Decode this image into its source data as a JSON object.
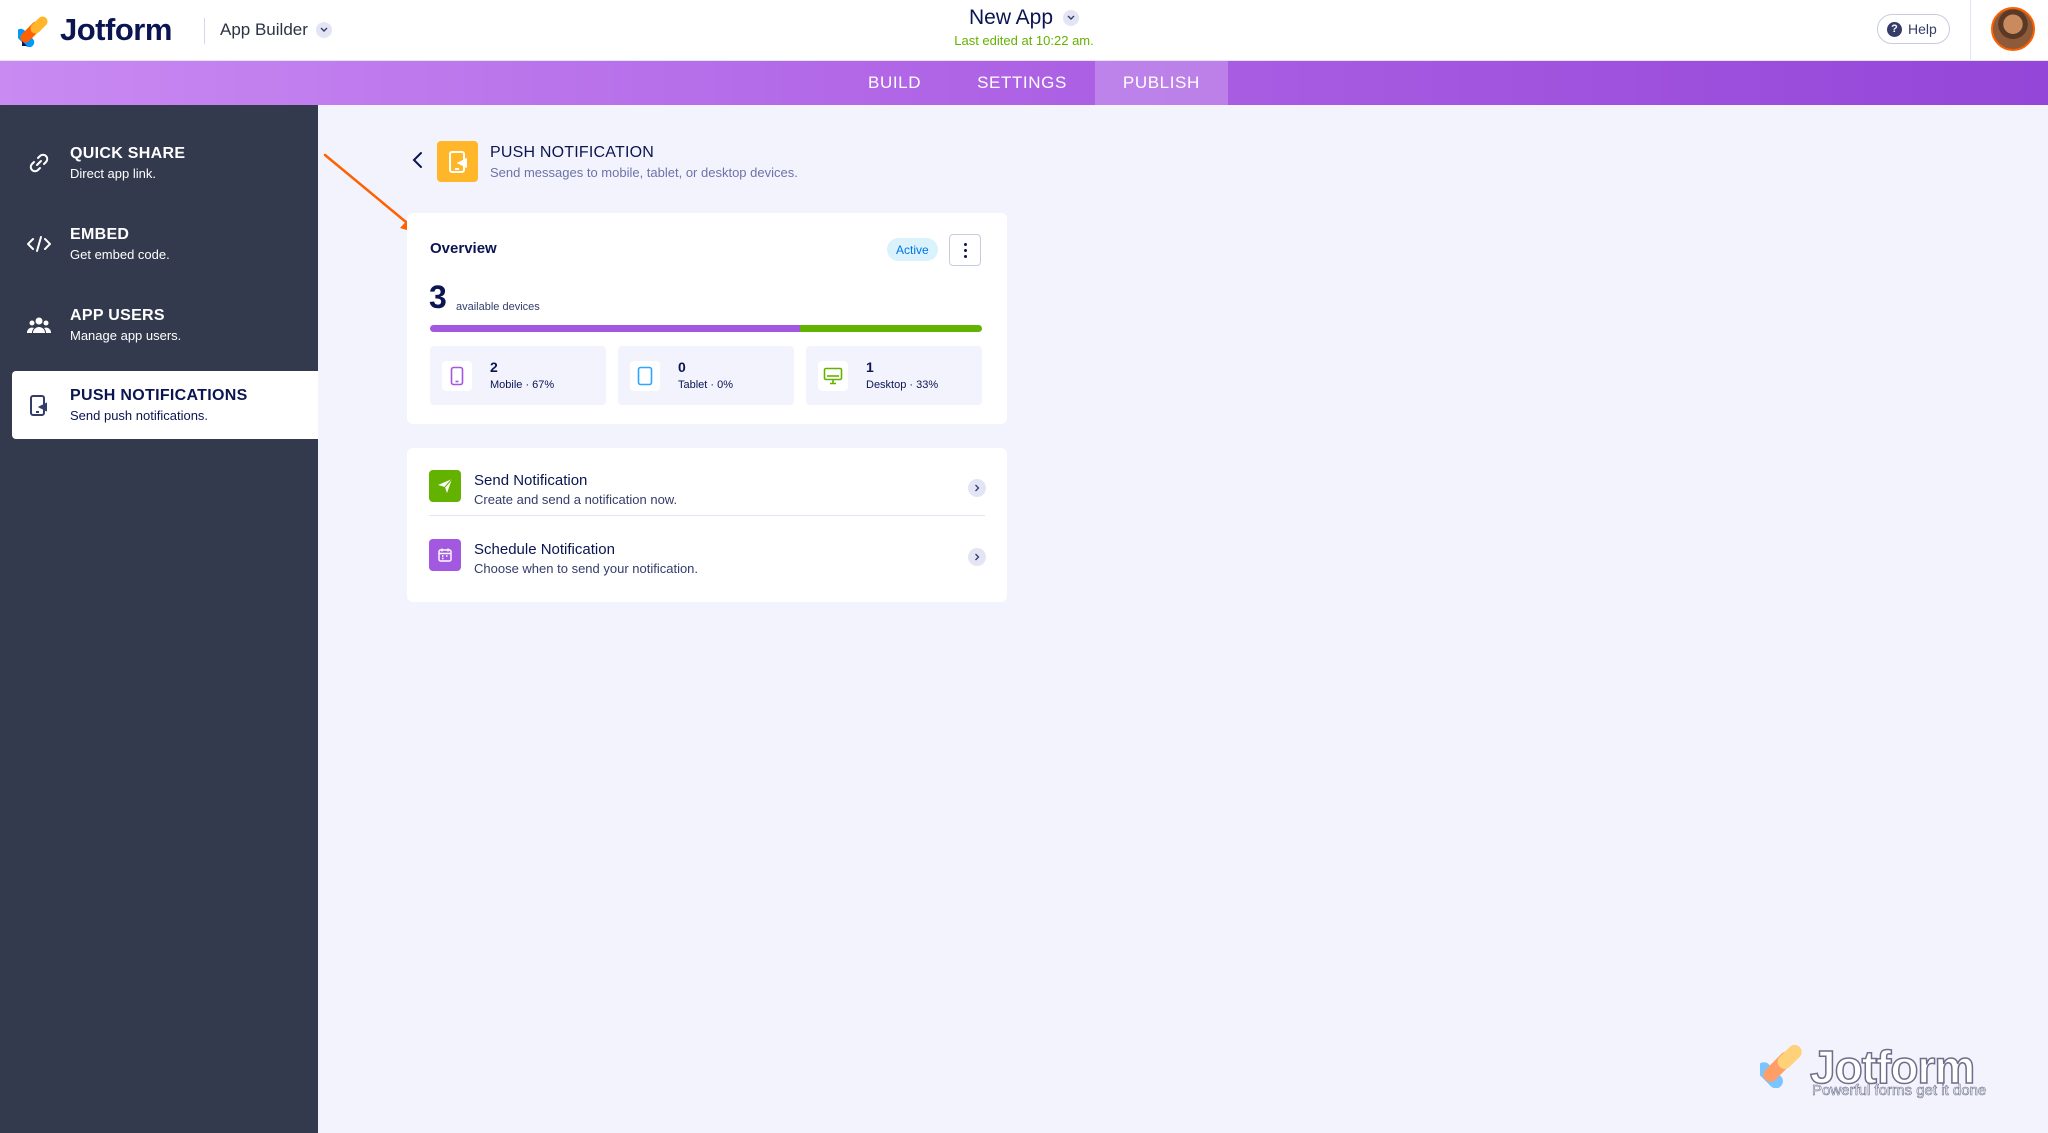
{
  "header": {
    "brand": "Jotform",
    "product_label": "App Builder",
    "app_title": "New App",
    "last_edited": "Last edited at 10:22 am.",
    "help_label": "Help"
  },
  "tabs": [
    {
      "label": "BUILD"
    },
    {
      "label": "SETTINGS"
    },
    {
      "label": "PUBLISH",
      "active": true
    }
  ],
  "sidebar": {
    "items": [
      {
        "title": "QUICK SHARE",
        "subtitle": "Direct app link.",
        "icon": "link-icon"
      },
      {
        "title": "EMBED",
        "subtitle": "Get embed code.",
        "icon": "code-icon"
      },
      {
        "title": "APP USERS",
        "subtitle": "Manage app users.",
        "icon": "users-icon"
      },
      {
        "title": "PUSH NOTIFICATIONS",
        "subtitle": "Send push notifications.",
        "icon": "push-notification-icon",
        "active": true
      }
    ]
  },
  "page": {
    "title": "PUSH NOTIFICATION",
    "subtitle": "Send messages to mobile, tablet, or desktop devices."
  },
  "overview": {
    "title": "Overview",
    "status": "Active",
    "device_count": "3",
    "device_count_label": "available devices",
    "progress_fractions": {
      "mobile": 0.67,
      "tablet": 0.0,
      "desktop": 0.33
    },
    "devices": [
      {
        "count": "2",
        "label": "Mobile · 67%",
        "icon": "mobile-icon",
        "color": "#a259e0"
      },
      {
        "count": "0",
        "label": "Tablet · 0%",
        "icon": "tablet-icon",
        "color": "#2fa5ff"
      },
      {
        "count": "1",
        "label": "Desktop · 33%",
        "icon": "desktop-icon",
        "color": "#64b200"
      }
    ]
  },
  "actions": [
    {
      "title": "Send Notification",
      "subtitle": "Create and send a notification now.",
      "icon": "send-icon",
      "color": "#64b200"
    },
    {
      "title": "Schedule Notification",
      "subtitle": "Choose when to send your notification.",
      "icon": "calendar-icon",
      "color": "#a259e0"
    }
  ],
  "watermark": {
    "brand": "Jotform",
    "tagline": "Powerful forms get it done"
  },
  "colors": {
    "accent_purple": "#a259e0",
    "accent_green": "#64b200",
    "accent_orange": "#ff6100",
    "sidebar_bg": "#343a4e",
    "page_bg": "#f3f3fe"
  }
}
